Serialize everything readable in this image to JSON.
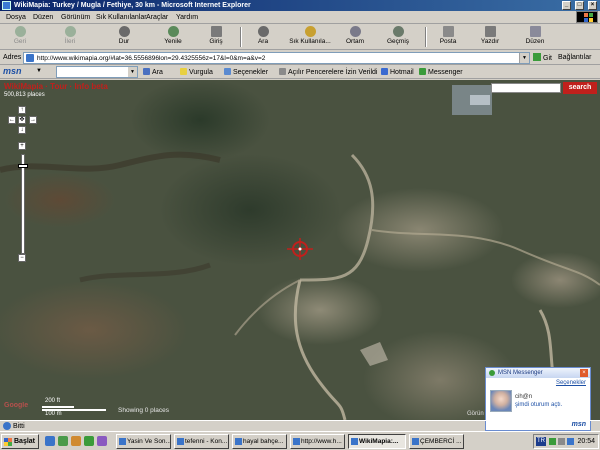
{
  "window": {
    "title": "WikiMapia: Turkey / Mugla / Fethiye, 30 km - Microsoft Internet Explorer",
    "controls": [
      "_",
      "□",
      "×"
    ]
  },
  "menu": {
    "items": [
      "Dosya",
      "Düzen",
      "Görünüm",
      "Sık Kullanılanlar",
      "Araçlar",
      "Yardım"
    ]
  },
  "toolbar": {
    "back": "Geri",
    "forward": "İleri",
    "stop": "Dur",
    "refresh": "Yenile",
    "home": "Giriş",
    "search": "Ara",
    "favorites": "Sık Kullanıla...",
    "media": "Ortam",
    "history": "Geçmiş",
    "mail": "Posta",
    "print": "Yazdır",
    "edit": "Düzen"
  },
  "address": {
    "label": "Adres",
    "url": "http://www.wikimapia.org/#lat=36.5556896lon=29.4325556z=17&l=0&m=a&v=2",
    "go": "Git",
    "links": "Bağlantılar"
  },
  "msnbar": {
    "logo": "msn",
    "search": "Ara",
    "highlight": "Vurgula",
    "options": "Seçenekler",
    "popups": "Açılır Pencerelere İzin Verildi",
    "hotmail": "Hotmail",
    "messenger": "Messenger"
  },
  "map": {
    "brand": "WikiMapia · Tour · Info beta",
    "places_count": "500,813 places",
    "search_button": "search",
    "scale_top": "200 ft",
    "scale_bottom": "100 m",
    "showing": "Showing 0 places",
    "credit": "Görün",
    "logo": "Google"
  },
  "msn_popup": {
    "title": "MSN Messenger",
    "options": "Seçenekler",
    "contact": "cih@n",
    "status": "şimdi oturum açtı.",
    "logo": "msn"
  },
  "status": {
    "text": "Bitti"
  },
  "taskbar": {
    "start": "Başlat",
    "tasks": [
      "Yasin Ve Son...",
      "tefenni - Kon...",
      "hayal bahçe...",
      "http://www.h...",
      "WikiMapia:...",
      "ÇEMBERCİ ..."
    ],
    "language": "TR",
    "clock": "20:54"
  }
}
